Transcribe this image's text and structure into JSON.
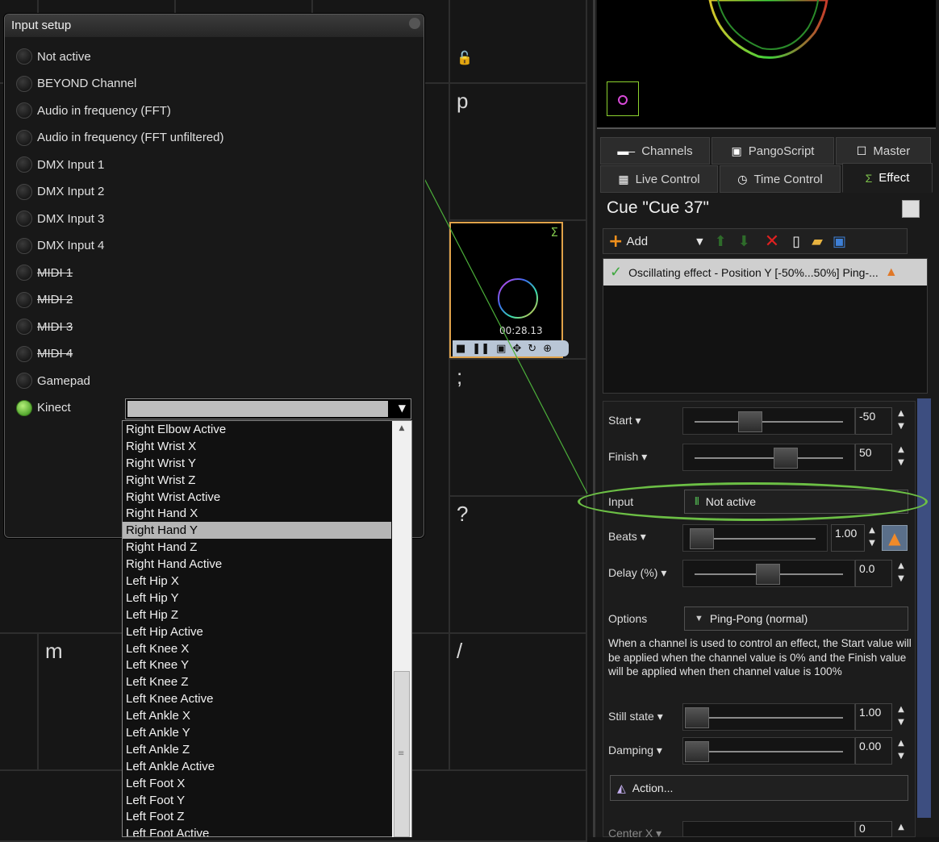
{
  "grid": {
    "keys": [
      "p",
      ":",
      ";",
      "?",
      "m",
      "/"
    ]
  },
  "thumbnail": {
    "time": "00:28.13",
    "sigma": "Σ"
  },
  "tabs": {
    "row1": [
      "Channels",
      "PangoScript",
      "Master"
    ],
    "row2": [
      "Live Control",
      "Time Control",
      "Effect"
    ],
    "active": "Effect"
  },
  "cue": {
    "title": "Cue \"Cue 37\""
  },
  "toolbar": {
    "add_label": "Add"
  },
  "effects": [
    {
      "label": "Oscillating effect - Position Y [-50%...50%] Ping-..."
    }
  ],
  "properties": {
    "start": {
      "label": "Start",
      "value": "-50"
    },
    "finish": {
      "label": "Finish",
      "value": "50"
    },
    "input": {
      "label": "Input",
      "value": "Not active"
    },
    "beats": {
      "label": "Beats",
      "value": "1.00"
    },
    "delay": {
      "label": "Delay (%)",
      "value": "0.0"
    },
    "options": {
      "label": "Options",
      "value": "Ping-Pong (normal)"
    },
    "description": "When a channel is used to control an effect, the Start value will be applied when the channel value is 0% and the Finish value will be applied when then channel value is 100%",
    "still_state": {
      "label": "Still state",
      "value": "1.00"
    },
    "damping": {
      "label": "Damping",
      "value": "0.00"
    },
    "action_label": "Action...",
    "center_x": {
      "label": "Center X",
      "value": "0"
    }
  },
  "input_setup": {
    "title": "Input setup",
    "options": [
      {
        "label": "Not active",
        "active": false,
        "strike": false
      },
      {
        "label": "BEYOND Channel",
        "active": false,
        "strike": false
      },
      {
        "label": "Audio in frequency (FFT)",
        "active": false,
        "strike": false
      },
      {
        "label": "Audio in frequency (FFT unfiltered)",
        "active": false,
        "strike": false
      },
      {
        "label": "DMX Input 1",
        "active": false,
        "strike": false
      },
      {
        "label": "DMX Input 2",
        "active": false,
        "strike": false
      },
      {
        "label": "DMX Input 3",
        "active": false,
        "strike": false
      },
      {
        "label": "DMX Input 4",
        "active": false,
        "strike": false
      },
      {
        "label": "MIDI 1",
        "active": false,
        "strike": true
      },
      {
        "label": "MIDI 2",
        "active": false,
        "strike": true
      },
      {
        "label": "MIDI 3",
        "active": false,
        "strike": true
      },
      {
        "label": "MIDI 4",
        "active": false,
        "strike": true
      },
      {
        "label": "Gamepad",
        "active": false,
        "strike": false
      },
      {
        "label": "Kinect",
        "active": true,
        "strike": false
      }
    ],
    "kinect_list": [
      "Right Elbow Active",
      "Right Wrist X",
      "Right Wrist Y",
      "Right Wrist Z",
      "Right Wrist Active",
      "Right Hand X",
      "Right Hand Y",
      "Right Hand Z",
      "Right Hand Active",
      "Left Hip X",
      "Left Hip Y",
      "Left Hip Z",
      "Left Hip Active",
      "Left Knee X",
      "Left Knee Y",
      "Left Knee Z",
      "Left Knee Active",
      "Left Ankle X",
      "Left Ankle Y",
      "Left Ankle Z",
      "Left Ankle Active",
      "Left Foot X",
      "Left Foot Y",
      "Left Foot Z",
      "Left Foot Active"
    ],
    "kinect_selected": "Right Hand Y"
  },
  "colors": {
    "highlight_green": "#6cbf45",
    "thumb_border": "#e0a24a",
    "scroll_blue": "#3d4e80"
  }
}
